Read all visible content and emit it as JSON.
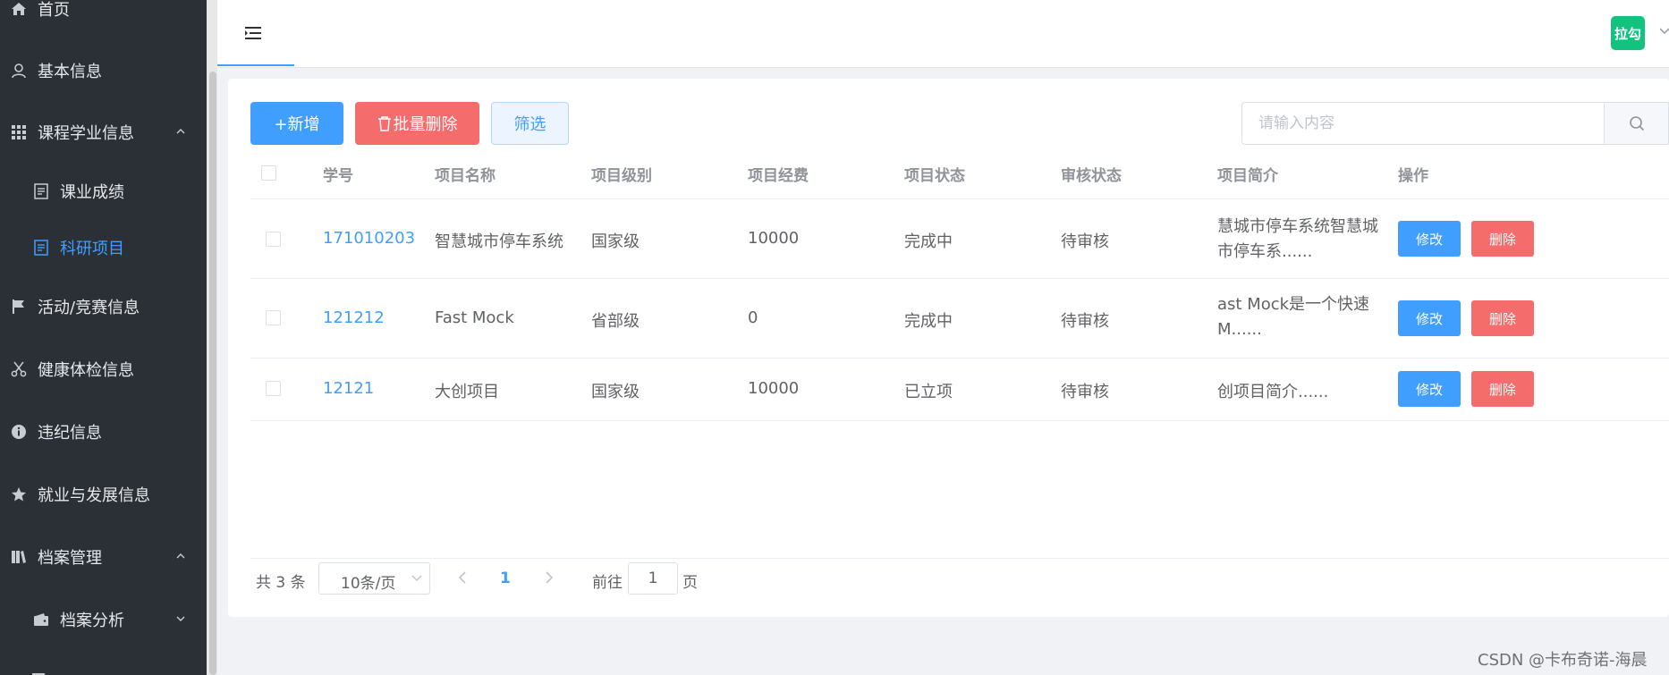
{
  "sidebar": {
    "items": [
      {
        "label": "首页",
        "icon": "home-icon"
      },
      {
        "label": "基本信息",
        "icon": "user-icon"
      },
      {
        "label": "课程学业信息",
        "icon": "grid-icon",
        "expanded": true
      },
      {
        "label": "课业成绩",
        "icon": "document-icon",
        "sub": true
      },
      {
        "label": "科研项目",
        "icon": "document-icon",
        "sub": true,
        "active": true
      },
      {
        "label": "活动/竞赛信息",
        "icon": "flag-icon"
      },
      {
        "label": "健康体检信息",
        "icon": "scissors-icon"
      },
      {
        "label": "违纪信息",
        "icon": "info-icon"
      },
      {
        "label": "就业与发展信息",
        "icon": "star-icon"
      },
      {
        "label": "档案管理",
        "icon": "archive-icon",
        "expanded": true
      },
      {
        "label": "档案分析",
        "icon": "wallet-icon",
        "sub": true
      }
    ],
    "active_color": "#409eff"
  },
  "header": {
    "avatar_text": "拉勾",
    "avatar_color": "#13c27f"
  },
  "toolbar": {
    "add_label": "+新增",
    "batch_delete_label": "批量删除",
    "filter_label": "筛选",
    "search_placeholder": "请输入内容"
  },
  "table": {
    "columns": [
      "学号",
      "项目名称",
      "项目级别",
      "项目经费",
      "项目状态",
      "审核状态",
      "项目简介",
      "操作"
    ],
    "rows": [
      {
        "id": "171010203",
        "name": "智慧城市停车系统",
        "level": "国家级",
        "funding": "10000",
        "status": "完成中",
        "review": "待审核",
        "summary": "慧城市停车系统智慧城市停车系......"
      },
      {
        "id": "121212",
        "name": "Fast Mock",
        "level": "省部级",
        "funding": "0",
        "status": "完成中",
        "review": "待审核",
        "summary": "ast Mock是一个快速M......"
      },
      {
        "id": "12121",
        "name": "大创项目",
        "level": "国家级",
        "funding": "10000",
        "status": "已立项",
        "review": "待审核",
        "summary": "创项目简介......"
      }
    ],
    "edit_label": "修改",
    "delete_label": "删除"
  },
  "pagination": {
    "total_text": "共 3 条",
    "page_size": "10条/页",
    "current_page": "1",
    "goto_label": "前往",
    "goto_value": "1",
    "page_suffix": "页"
  },
  "watermark": "CSDN @卡布奇诺-海晨",
  "colors": {
    "primary": "#409eff",
    "danger": "#f56c6c",
    "sidebar_bg": "#2b3036"
  }
}
